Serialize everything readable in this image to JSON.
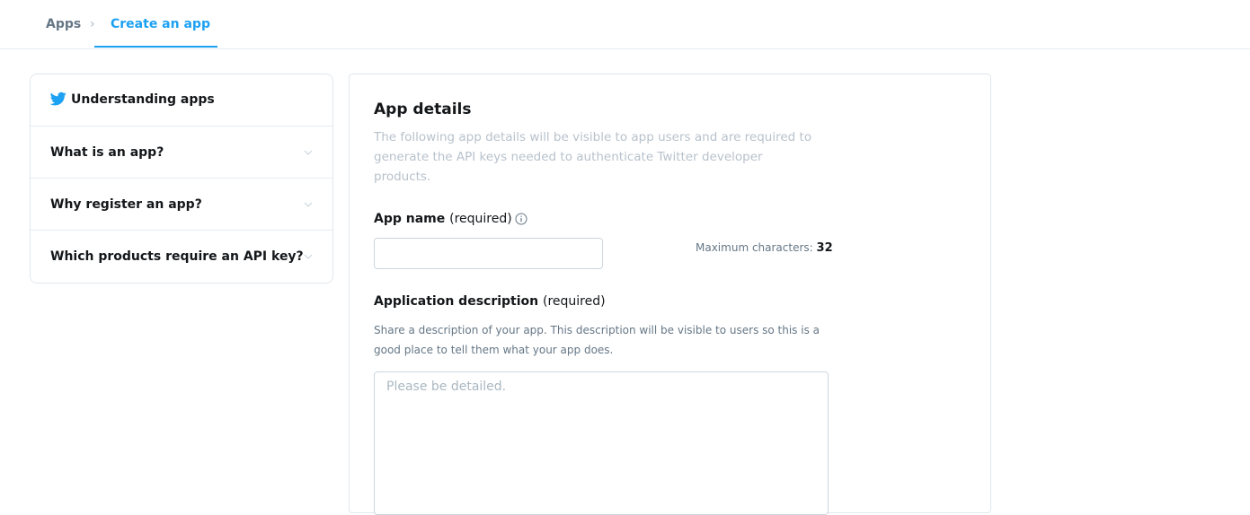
{
  "breadcrumb": {
    "apps": "Apps",
    "separator": "›",
    "current": "Create an app"
  },
  "sidebar": {
    "title": "Understanding apps",
    "items": [
      {
        "label": "What is an app?"
      },
      {
        "label": "Why register an app?"
      },
      {
        "label": "Which products require an API key?"
      }
    ]
  },
  "main": {
    "title": "App details",
    "description": "The following app details will be visible to app users and are required to generate the API keys needed to authenticate Twitter developer products.",
    "app_name": {
      "label": "App name",
      "required": "(required)",
      "value": "",
      "max_label": "Maximum characters:",
      "max_value": "32"
    },
    "app_desc": {
      "label": "Application description",
      "required": "(required)",
      "help": "Share a description of your app. This description will be visible to users so this is a good place to tell them what your app does.",
      "placeholder": "Please be detailed."
    }
  },
  "colors": {
    "accent": "#1da1f2",
    "text": "#14171a",
    "muted": "#657786"
  }
}
